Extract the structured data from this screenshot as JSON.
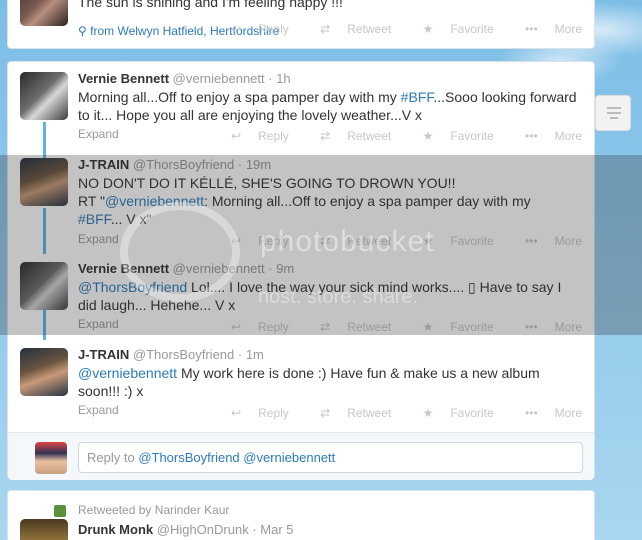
{
  "top_tweet": {
    "text": "The sun is shining and I'm feeling happy !!!",
    "location": "from Welwyn Hatfield, Hertfordshire"
  },
  "actions": {
    "reply": "Reply",
    "retweet": "Retweet",
    "favorite": "Favorite",
    "more": "More"
  },
  "expand_label": "Expand",
  "tweets": [
    {
      "name": "Vernie Bennett",
      "handle": "@verniebennett",
      "time": "· 1h",
      "text_parts": [
        "Morning all...Off to enjoy a spa pamper day with my ",
        "#BFF",
        "...Sooo looking forward to it... Hope you all are enjoying the lovely weather...V x"
      ]
    },
    {
      "name": "J-TRAIN",
      "handle": "@ThorsBoyfriend",
      "time": "· 19m",
      "line1": "NO DON'T DO IT KÉLLÉ, SHE'S GOING TO DROWN YOU!!",
      "text_parts": [
        "RT \"",
        "@verniebennett",
        ": Morning all...Off to enjoy a spa pamper day with my ",
        "#BFF",
        "... V x\""
      ]
    },
    {
      "name": "Vernie Bennett",
      "handle": "@verniebennett",
      "time": "· 9m",
      "text_parts": [
        "@ThorsBoyfriend",
        " Lol.... I love the way your sick mind works.... ▯ Have to say I did laugh... Hehehe... V x"
      ]
    },
    {
      "name": "J-TRAIN",
      "handle": "@ThorsBoyfriend",
      "time": "· 1m",
      "text_parts": [
        "@verniebennett",
        " My work here is done :) Have fun & make us a new album soon!!! :) x"
      ]
    }
  ],
  "reply_box": {
    "prefix": "Reply to ",
    "mentions": "@ThorsBoyfriend @verniebennett"
  },
  "bottom_tweet": {
    "retweeted_by": "Retweeted by Narinder Kaur",
    "name": "Drunk Monk",
    "handle": "@HighOnDrunk",
    "time": "· Mar 5"
  },
  "watermark": {
    "title": "photobucket",
    "sub": "host. store. share."
  },
  "colors": {
    "link": "#2b7bb9",
    "thread_line": "#60b3e8",
    "background": "#8ec5e8"
  }
}
